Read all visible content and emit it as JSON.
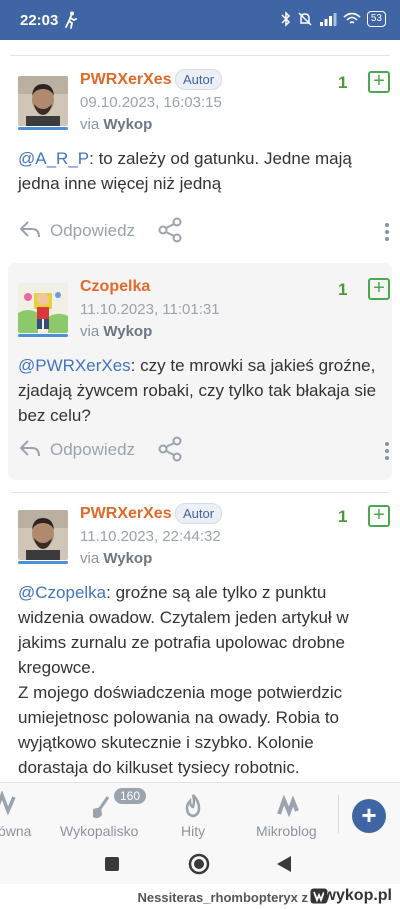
{
  "status_bar": {
    "time": "22:03",
    "battery": "53"
  },
  "comments": [
    {
      "author": "PWRXerXes",
      "badge": "Autor",
      "date": "09.10.2023, 16:03:15",
      "via_prefix": "via",
      "via_app": "Wykop",
      "votes": "1",
      "mention": "@A_R_P",
      "text": ": to zależy od gatunku. Jedne mają jedna inne więcej niż jedną",
      "reply_label": "Odpowiedz"
    },
    {
      "author": "Czopelka",
      "date": "11.10.2023, 11:01:31",
      "via_prefix": "via",
      "via_app": "Wykop",
      "votes": "1",
      "mention": "@PWRXerXes",
      "text": ": czy te mrowki sa jakieś groźne, zjadają żywcem robaki, czy tylko tak błakaja sie bez celu?",
      "reply_label": "Odpowiedz"
    },
    {
      "author": "PWRXerXes",
      "badge": "Autor",
      "date": "11.10.2023, 22:44:32",
      "via_prefix": "via",
      "via_app": "Wykop",
      "votes": "1",
      "mention": "@Czopelka",
      "text": ": groźne są ale tylko z punktu widzenia owadow. Czytalem jeden artykuł w jakims zurnalu ze potrafia upolowac drobne kregowce.",
      "text2": "Z mojego doświadczenia moge potwierdzic umiejetnosc polowania na owady. Robia to wyjątkowo skutecznie i szybko. Kolonie dorastaja do kilkuset tysiecy robotnic."
    }
  ],
  "bottom_nav": {
    "items": [
      {
        "label": "ówna",
        "icon": "home-icon"
      },
      {
        "label": "Wykopalisko",
        "icon": "shovel-icon",
        "badge": "160"
      },
      {
        "label": "Hity",
        "icon": "fire-icon"
      },
      {
        "label": "Mikroblog",
        "icon": "microblog-icon"
      }
    ],
    "fab": "+"
  },
  "watermark": {
    "text": "Nessiteras_rhombopteryx z",
    "logo": "wykop.pl"
  },
  "colors": {
    "primary": "#3f65a4",
    "author": "#e06a29",
    "mention": "#3f75c0",
    "vote": "#4aa84f"
  }
}
